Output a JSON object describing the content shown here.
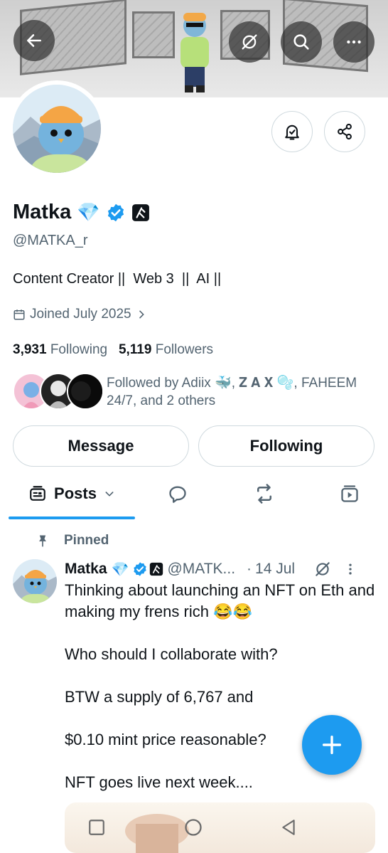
{
  "profile": {
    "name": "Matka",
    "name_emoji": "💎",
    "handle": "@MATKA_r",
    "bio": "Content Creator ||  Web 3  ||  AI ||",
    "joined": "Joined July 2025",
    "following_count": "3,931",
    "following_label": "Following",
    "followers_count": "5,119",
    "followers_label": "Followers",
    "followed_by": "Followed by Adiix 🐳, 𝐙 𝐀 𝐗 🫧, FAHEEM 24/7, and 2 others"
  },
  "actions": {
    "message_label": "Message",
    "following_button_label": "Following"
  },
  "tabs": {
    "posts_label": "Posts"
  },
  "pinned_post": {
    "pinned_label": "Pinned",
    "author_name": "Matka",
    "author_emoji": "💎",
    "handle": "@MATK...",
    "separator": "·",
    "date": "14 Jul",
    "paragraphs": [
      "Thinking about launching an NFT on Eth and making my frens rich 😂😂",
      "Who should I collaborate with?",
      "BTW  a supply of 6,767 and",
      "$0.10 mint price reasonable?",
      "NFT goes live next week...."
    ]
  },
  "colors": {
    "accent": "#1d9bf0",
    "text": "#0f1419",
    "muted": "#536471",
    "border": "#cfd9de"
  },
  "icons": [
    "back-arrow-icon",
    "grok-icon",
    "search-icon",
    "more-icon",
    "notification-bell-icon",
    "share-icon",
    "verified-badge-icon",
    "affiliate-badge-icon",
    "calendar-icon",
    "chevron-right-icon",
    "posts-tab-icon",
    "chevron-down-icon",
    "replies-icon",
    "repost-icon",
    "media-icon",
    "pin-icon",
    "plus-icon",
    "recent-apps-icon",
    "home-icon",
    "back-nav-icon"
  ]
}
